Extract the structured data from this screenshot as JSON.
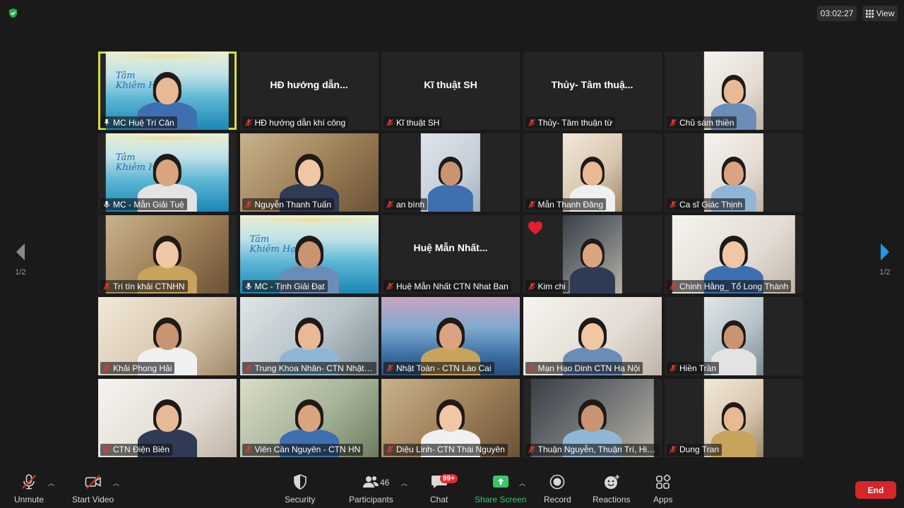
{
  "meeting": {
    "timer": "03:02:27",
    "view_label": "View",
    "page_indicator_left": "1/2",
    "page_indicator_right": "1/2"
  },
  "banner": {
    "title_line1": "Tâm",
    "title_line2": "Khiêm Hạ"
  },
  "participants": [
    {
      "name": "MC Huệ Trí Căn",
      "muted": false,
      "pinned": true,
      "video": true,
      "bg": "meet",
      "width": "wide",
      "active": true,
      "banner": true
    },
    {
      "name": "HĐ hướng dẫn khí công",
      "title": "HĐ hướng dẫn...",
      "muted": true,
      "video": false
    },
    {
      "name": "Kĩ thuật SH",
      "title": "Kĩ thuật SH",
      "muted": true,
      "video": false
    },
    {
      "name": "Thủy- Tâm thuận từ",
      "title": "Thủy- Tâm thuậ...",
      "muted": true,
      "video": false
    },
    {
      "name": "Chủ sám thiền",
      "muted": true,
      "video": true,
      "bg": "room4",
      "width": "narrow"
    },
    {
      "name": "MC - Mẫn Giải Tuệ",
      "muted": false,
      "video": true,
      "bg": "meet",
      "width": "wide",
      "banner": true
    },
    {
      "name": "Nguyễn Thanh Tuấn",
      "muted": true,
      "video": true,
      "bg": "room3",
      "width": "full"
    },
    {
      "name": "an bình",
      "muted": true,
      "video": true,
      "bg": "window",
      "width": "narrow"
    },
    {
      "name": "Mẫn Thanh Đăng",
      "muted": true,
      "video": true,
      "bg": "room1",
      "width": "narrow"
    },
    {
      "name": "Ca sĩ Giác Thịnh",
      "muted": true,
      "video": true,
      "bg": "room4",
      "width": "narrow"
    },
    {
      "name": "Trí tín khải CTNHN",
      "muted": true,
      "video": true,
      "bg": "room3",
      "width": "wide"
    },
    {
      "name": "MC - Tịnh Giải Đạt",
      "muted": false,
      "video": true,
      "bg": "meet",
      "width": "full",
      "banner": true
    },
    {
      "name": "Huệ Mẫn Nhất CTN Nhat Ban",
      "title": "Huệ Mẫn Nhất...",
      "muted": true,
      "video": false
    },
    {
      "name": "Kim chi",
      "muted": true,
      "video": true,
      "bg": "dark",
      "width": "narrow",
      "heart": true
    },
    {
      "name": "Chinh Hằng_ Tổ Long Thành",
      "muted": true,
      "video": true,
      "bg": "room4",
      "width": "wide"
    },
    {
      "name": "Khải Phong Hải",
      "muted": true,
      "video": true,
      "bg": "room1",
      "width": "full"
    },
    {
      "name": "Trung Khoa Nhân- CTN Nhật ...",
      "muted": true,
      "video": true,
      "bg": "room2",
      "width": "full"
    },
    {
      "name": "Nhật Toàn - CTN Lào Cai",
      "muted": true,
      "video": true,
      "bg": "mount",
      "width": "full"
    },
    {
      "name": "Mạn Hạo Dinh CTN Hạ Nội",
      "muted": true,
      "video": true,
      "bg": "room4",
      "width": "full"
    },
    {
      "name": "Hiền Trần",
      "muted": true,
      "video": true,
      "bg": "room2",
      "width": "narrow"
    },
    {
      "name": "CTN Điện Biên",
      "muted": true,
      "video": true,
      "bg": "room4",
      "width": "full"
    },
    {
      "name": "Viên Cần Nguyên - CTN HN",
      "muted": true,
      "video": true,
      "bg": "green",
      "width": "full"
    },
    {
      "name": "Diệu Linh- CTN Thái Nguyên",
      "muted": true,
      "video": true,
      "bg": "room3",
      "width": "full"
    },
    {
      "name": "Thuận Nguyễn, Thuận Trí, Hiề...",
      "muted": true,
      "video": true,
      "bg": "dark",
      "width": "wide"
    },
    {
      "name": "Dung Tran",
      "muted": true,
      "video": true,
      "bg": "room1",
      "width": "narrow"
    }
  ],
  "toolbar": {
    "unmute_label": "Unmute",
    "start_video_label": "Start Video",
    "security_label": "Security",
    "participants_label": "Participants",
    "participants_count": "46",
    "chat_label": "Chat",
    "chat_badge": "99+",
    "share_screen_label": "Share Screen",
    "record_label": "Record",
    "reactions_label": "Reactions",
    "apps_label": "Apps",
    "end_label": "End"
  },
  "colors": {
    "active_speaker": "#d7df3a",
    "share_green": "#36c765",
    "end_red": "#d5272a",
    "muted_red": "#e0392e",
    "nav_blue": "#1e9be6"
  }
}
